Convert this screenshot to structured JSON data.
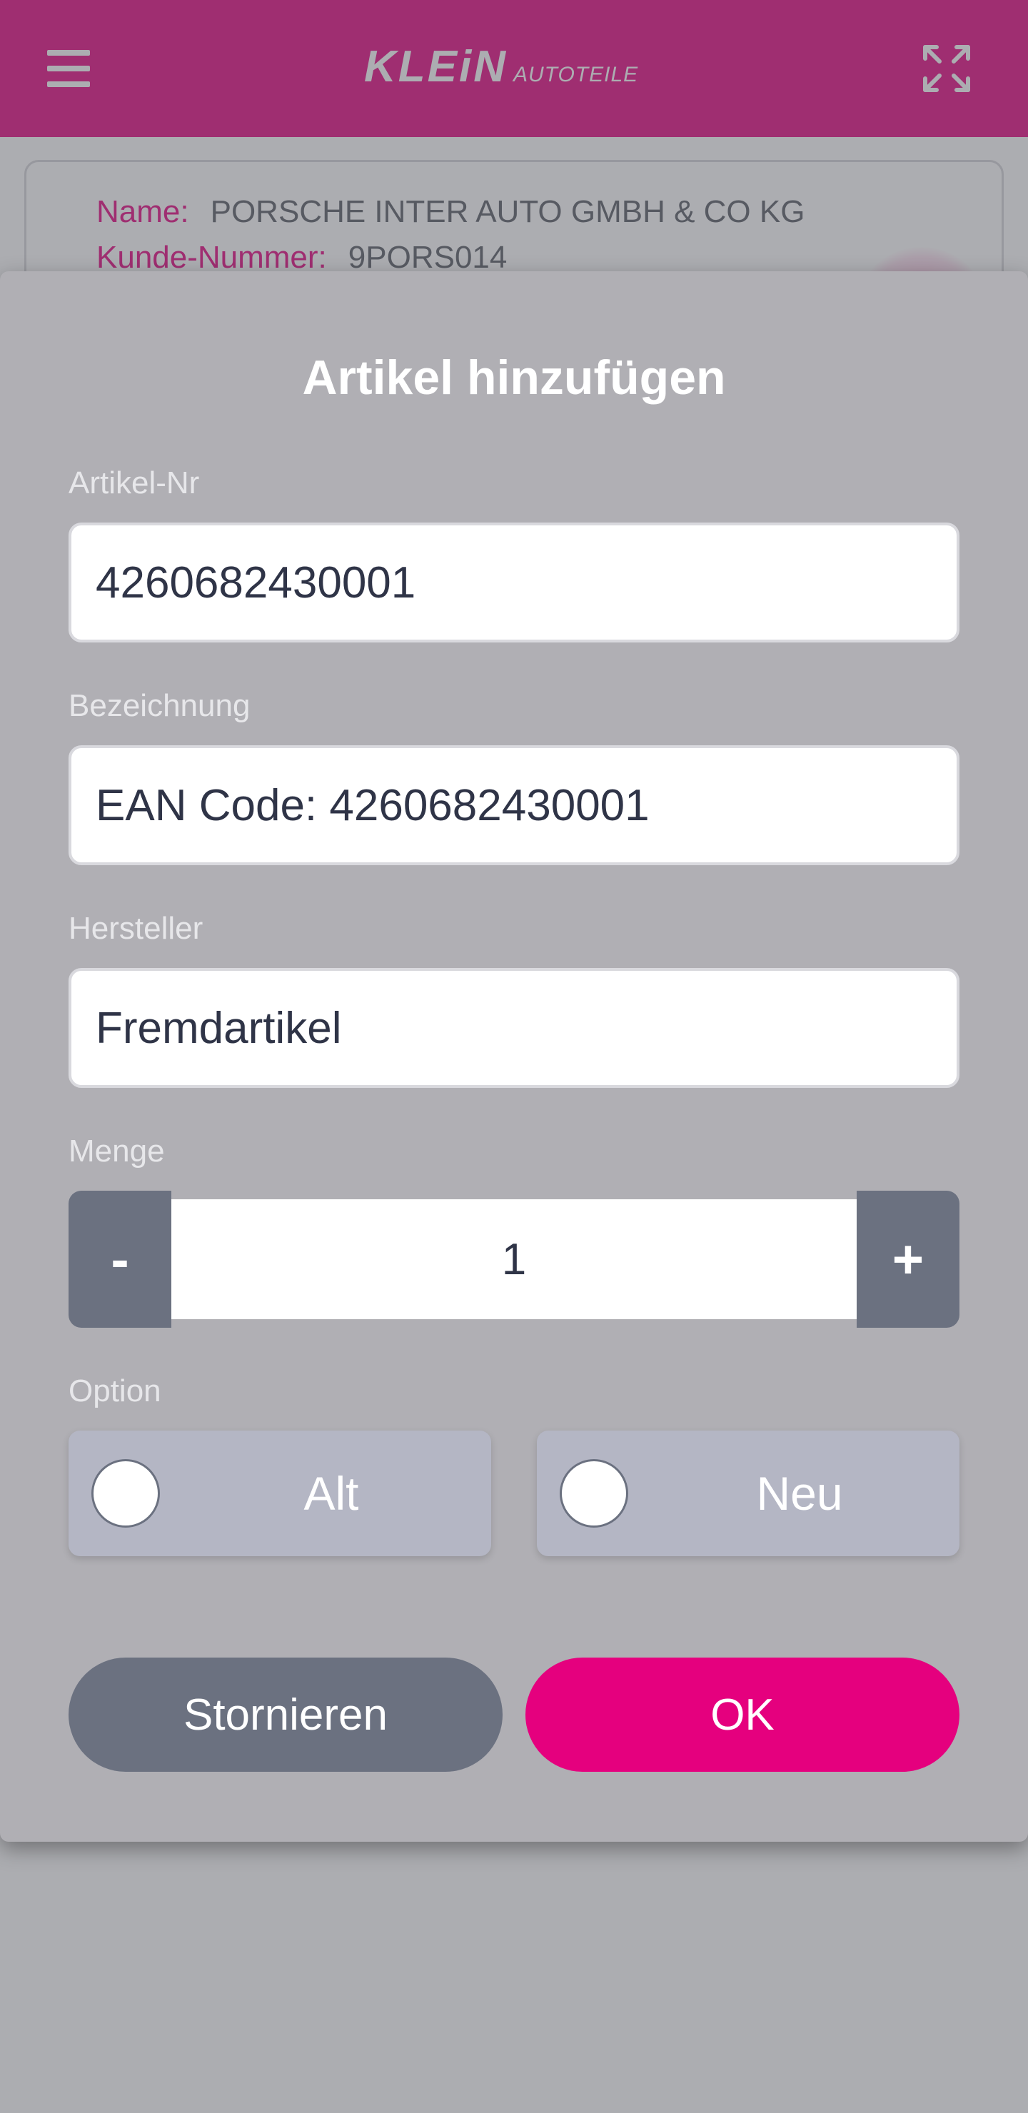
{
  "app": {
    "logo_main": "KLEiN",
    "logo_sub": "AUTOTEILE",
    "menu_icon": "hamburger-menu-icon",
    "expand_icon": "fullscreen-expand-icon",
    "brand_color": "#e5007e"
  },
  "customer": {
    "name_label": "Name:",
    "name_value": "PORSCHE INTER AUTO GMBH & CO KG",
    "number_label": "Kunde-Nummer:",
    "number_value": "9PORS014"
  },
  "dialog": {
    "title": "Artikel hinzufügen",
    "article_label": "Artikel-Nr",
    "article_value": "4260682430001",
    "description_label": "Bezeichnung",
    "description_value": "EAN Code: 4260682430001",
    "manufacturer_label": "Hersteller",
    "manufacturer_value": "Fremdartikel",
    "quantity_label": "Menge",
    "quantity_minus": "-",
    "quantity_value": "1",
    "quantity_plus": "+",
    "option_label": "Option",
    "options": [
      {
        "label": "Alt",
        "selected": false
      },
      {
        "label": "Neu",
        "selected": false
      }
    ],
    "cancel_label": "Stornieren",
    "ok_label": "OK"
  }
}
